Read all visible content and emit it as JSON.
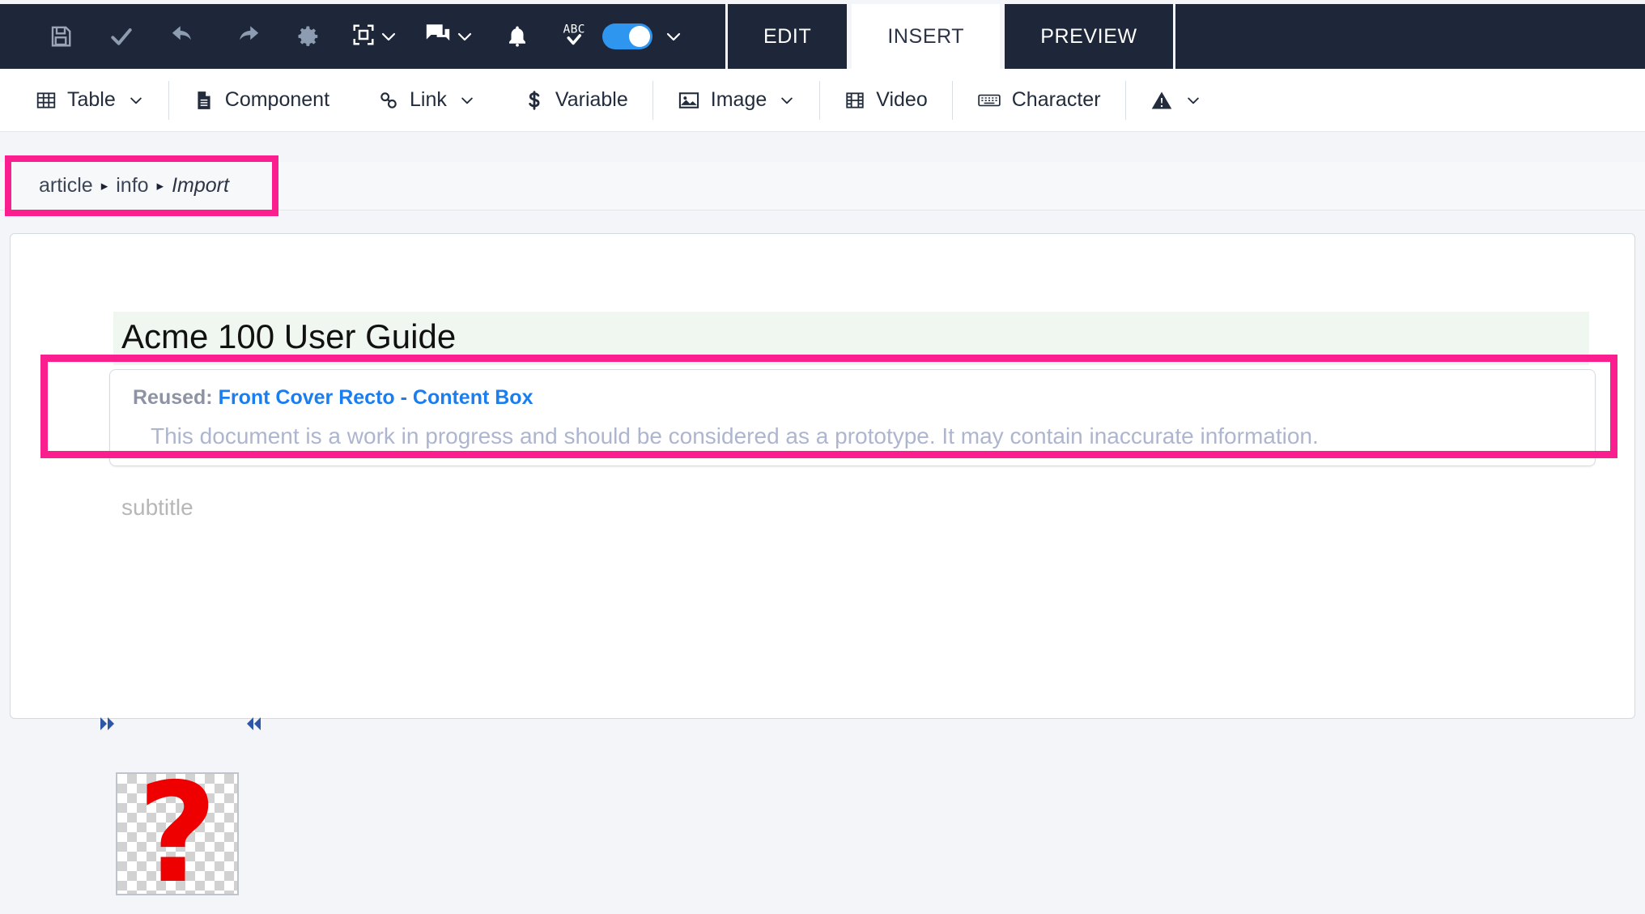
{
  "topbar": {
    "icons": [
      {
        "name": "save-icon",
        "label": "Save"
      },
      {
        "name": "check-icon",
        "label": "Validate"
      },
      {
        "name": "undo-icon",
        "label": "Undo"
      },
      {
        "name": "redo-icon",
        "label": "Redo"
      },
      {
        "name": "gear-icon",
        "label": "Settings"
      },
      {
        "name": "fullscreen-icon",
        "label": "Fullscreen"
      },
      {
        "name": "comment-icon",
        "label": "Comments"
      },
      {
        "name": "bell-icon",
        "label": "Notifications"
      }
    ],
    "spellcheck": {
      "icon": "abc-spellcheck-icon",
      "label": "ABC",
      "enabled": true,
      "toggle_color": "#2f96f0"
    },
    "tabs": [
      {
        "label": "EDIT",
        "active": false
      },
      {
        "label": "INSERT",
        "active": true
      },
      {
        "label": "PREVIEW",
        "active": false
      }
    ],
    "background": "#1e2639"
  },
  "toolbar": {
    "items": [
      {
        "label": "Table",
        "icon": "table-icon",
        "caret": true
      },
      {
        "label": "Component",
        "icon": "document-icon",
        "caret": false
      },
      {
        "label": "Link",
        "icon": "link-icon",
        "caret": true
      },
      {
        "label": "Variable",
        "icon": "dollar-icon",
        "caret": false
      },
      {
        "label": "Image",
        "icon": "image-icon",
        "caret": true
      },
      {
        "label": "Video",
        "icon": "film-icon",
        "caret": false
      },
      {
        "label": "Character",
        "icon": "keyboard-icon",
        "caret": false
      },
      {
        "label": "",
        "icon": "warning-triangle-icon",
        "caret": true
      }
    ]
  },
  "breadcrumb": {
    "items": [
      "article",
      "info",
      "Import"
    ],
    "separator": "▸",
    "current": "Import",
    "highlight_color": "#fa1e8e"
  },
  "document": {
    "title": "Acme 100 User Guide",
    "title_background": "#f0f6f0",
    "subtitle_placeholder": "subtitle",
    "reused": {
      "prefix": "Reused:",
      "link": "Front Cover Recto - Content Box",
      "link_color": "#1a7ef0",
      "body": "This document is a work in progress and should be considered as a prototype. It may contain inaccurate information.",
      "highlight_color": "#fa1e8e"
    },
    "image_placeholder": {
      "glyph": "?",
      "glyph_color": "#ee0000",
      "left_marker": "▸▸",
      "right_marker": "◂◂"
    }
  }
}
